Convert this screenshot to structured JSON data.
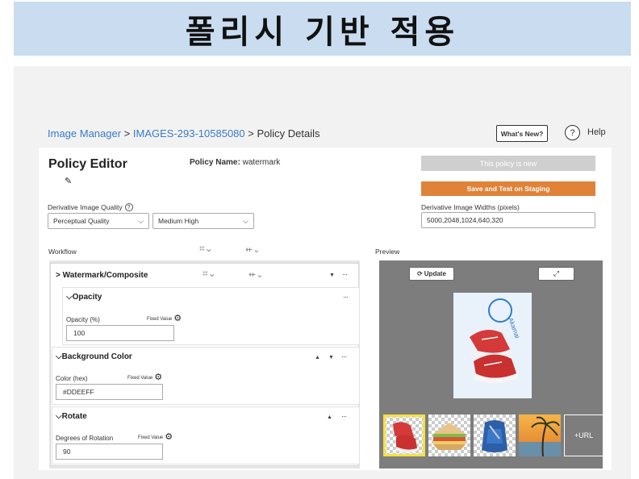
{
  "banner": {
    "title": "폴리시 기반 적용"
  },
  "breadcrumb": {
    "items": [
      "Image Manager",
      "IMAGES-293-10585080",
      "Policy Details"
    ],
    "separator": " > "
  },
  "header": {
    "whats_new": "What's New?",
    "help_icon_text": "?",
    "help": "Help"
  },
  "editor": {
    "title": "Policy Editor",
    "policy_name_label": "Policy Name:",
    "policy_name_value": "watermark",
    "status_button": "This policy is new",
    "save_button": "Save and Test on Staging",
    "quality_label": "Derivative Image Quality",
    "quality_help": "?",
    "quality_type": "Perceptual Quality",
    "quality_level": "Medium High",
    "widths_label": "Derivative Image Widths (pixels)",
    "widths_value": "5000,2048,1024,640,320",
    "workflow_label": "Workflow",
    "preview_label": "Preview"
  },
  "workflow": {
    "step_title": "Watermark/Composite",
    "sections": [
      {
        "title": "Opacity",
        "field_label": "Opacity (%)",
        "mode": "Fixed Value",
        "value": "100"
      },
      {
        "title": "Background Color",
        "field_label": "Color (hex)",
        "mode": "Fixed Value",
        "value": "#DDEEFF"
      },
      {
        "title": "Rotate",
        "field_label": "Degrees of Rotation",
        "mode": "Fixed Value",
        "value": "90"
      }
    ]
  },
  "preview": {
    "update_button": "Update",
    "watermark_text": "Akamai",
    "thumbnails": [
      "sneakers",
      "sandwich",
      "backpack",
      "beach"
    ],
    "selected_thumbnail": 0,
    "add_url_button": "+URL"
  },
  "colors": {
    "banner_bg": "#c9dcf0",
    "link": "#3a7bc8",
    "save_button": "#e08339",
    "status_button": "#cfcfcf",
    "preview_bg": "#7d7d7d",
    "selected_thumb": "#f5e23f"
  }
}
